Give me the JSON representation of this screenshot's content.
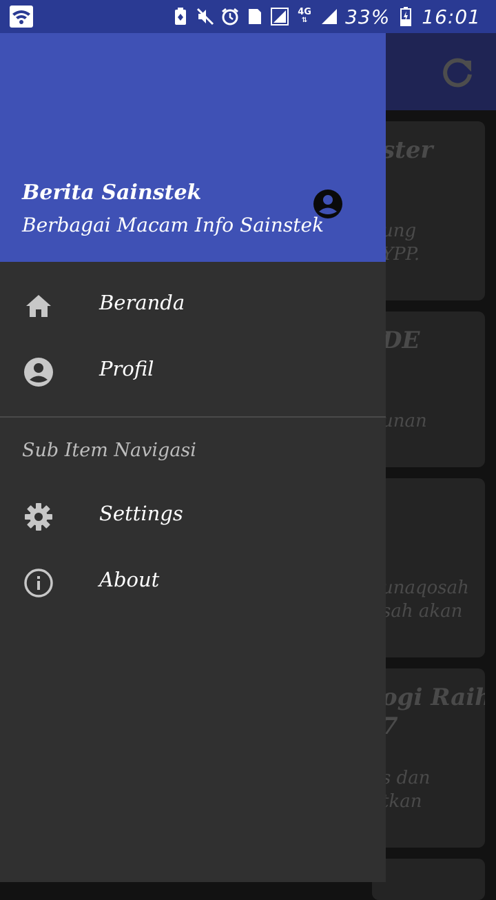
{
  "status_bar": {
    "battery": "33%",
    "time": "16:01",
    "sim": "1",
    "network": "4G",
    "icons": [
      "wifi-icon",
      "battery-saver-icon",
      "mute-icon",
      "alarm-icon",
      "sim-icon",
      "signal-icon",
      "network-4g-icon",
      "signal-icon",
      "battery-icon"
    ]
  },
  "drawer": {
    "header": {
      "title": "Berita Sainstek",
      "subtitle": "Berbagai Macam Info Sainstek",
      "avatar_icon": "account-circle-icon"
    },
    "main_items": [
      {
        "label": "Beranda",
        "icon": "home-icon"
      },
      {
        "label": "Profil",
        "icon": "account-circle-icon"
      }
    ],
    "subheader": "Sub Item Navigasi",
    "sub_items": [
      {
        "label": "Settings",
        "icon": "gear-icon"
      },
      {
        "label": "About",
        "icon": "info-icon"
      }
    ]
  },
  "background": {
    "toolbar_action_icon": "refresh-icon",
    "cards": [
      {
        "title": "ster",
        "text": [
          "ung",
          "YPP."
        ]
      },
      {
        "title": "DE",
        "text": [
          "unan"
        ]
      },
      {
        "title": "",
        "text": [
          "unaqosah",
          "sah akan"
        ]
      },
      {
        "title": "ogi Raih",
        "title2": "7",
        "text": [
          "s dan",
          "tkan"
        ]
      }
    ]
  },
  "colors": {
    "status_bar": "#2a3a93",
    "drawer_header": "#3f51b5",
    "drawer_body": "#303030",
    "scrim_toolbar": "#1f2454",
    "scrim_background": "#121212"
  }
}
